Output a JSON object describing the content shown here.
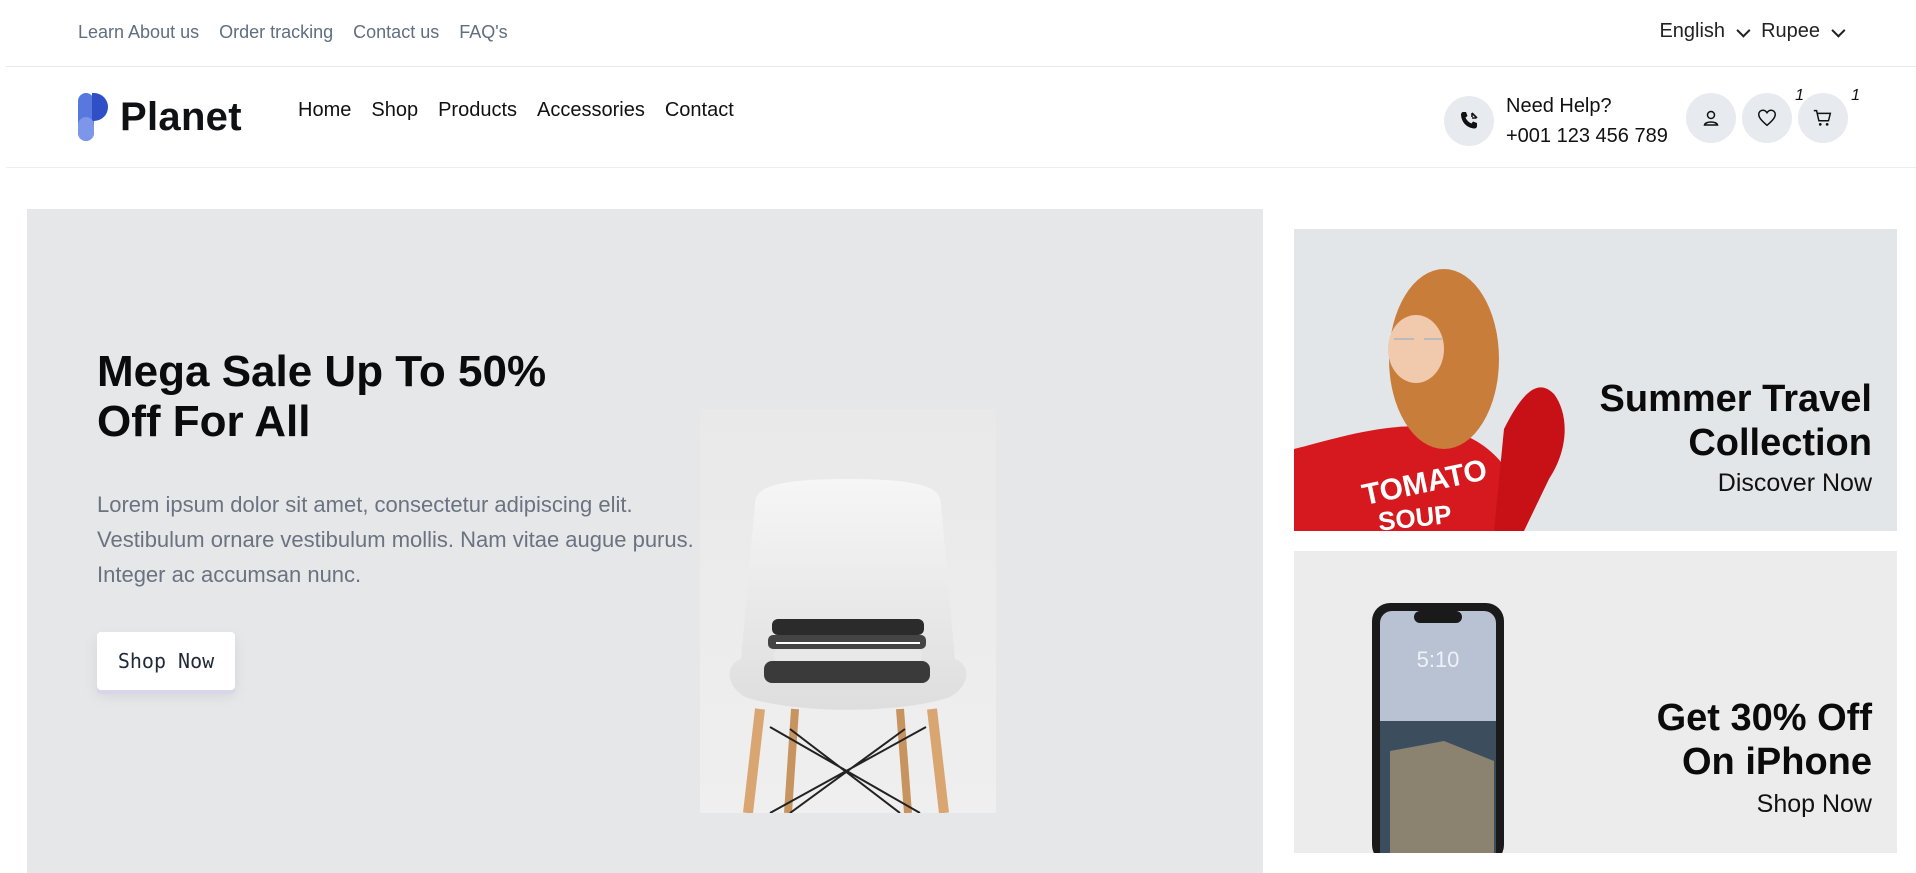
{
  "topbar": {
    "links": [
      "Learn About us",
      "Order tracking",
      "Contact us",
      "FAQ's"
    ],
    "language": "English",
    "currency": "Rupee"
  },
  "header": {
    "logo_text": "Planet",
    "nav": [
      "Home",
      "Shop",
      "Products",
      "Accessories",
      "Contact"
    ],
    "help_label": "Need Help?",
    "help_phone": "+001 123 456 789",
    "wishlist_count": "1",
    "cart_count": "1"
  },
  "hero": {
    "title_line1": "Mega Sale Up To 50%",
    "title_line2": "Off For All",
    "description": "Lorem ipsum dolor sit amet, consectetur adipiscing elit. Vestibulum ornare vestibulum mollis. Nam vitae augue purus. Integer ac accumsan nunc.",
    "button_label": "Shop Now"
  },
  "promos": [
    {
      "title_line1": "Summer Travel",
      "title_line2": "Collection",
      "cta": "Discover Now",
      "image_shirt_text": "TOMATO SOUP"
    },
    {
      "title_line1": "Get 30% Off",
      "title_line2": "On iPhone",
      "cta": "Shop Now",
      "phone_time": "5:10"
    }
  ],
  "colors": {
    "accent_blue": "#3b63d6",
    "hero_bg": "#e5e7e9",
    "muted_text": "#6b7280"
  }
}
